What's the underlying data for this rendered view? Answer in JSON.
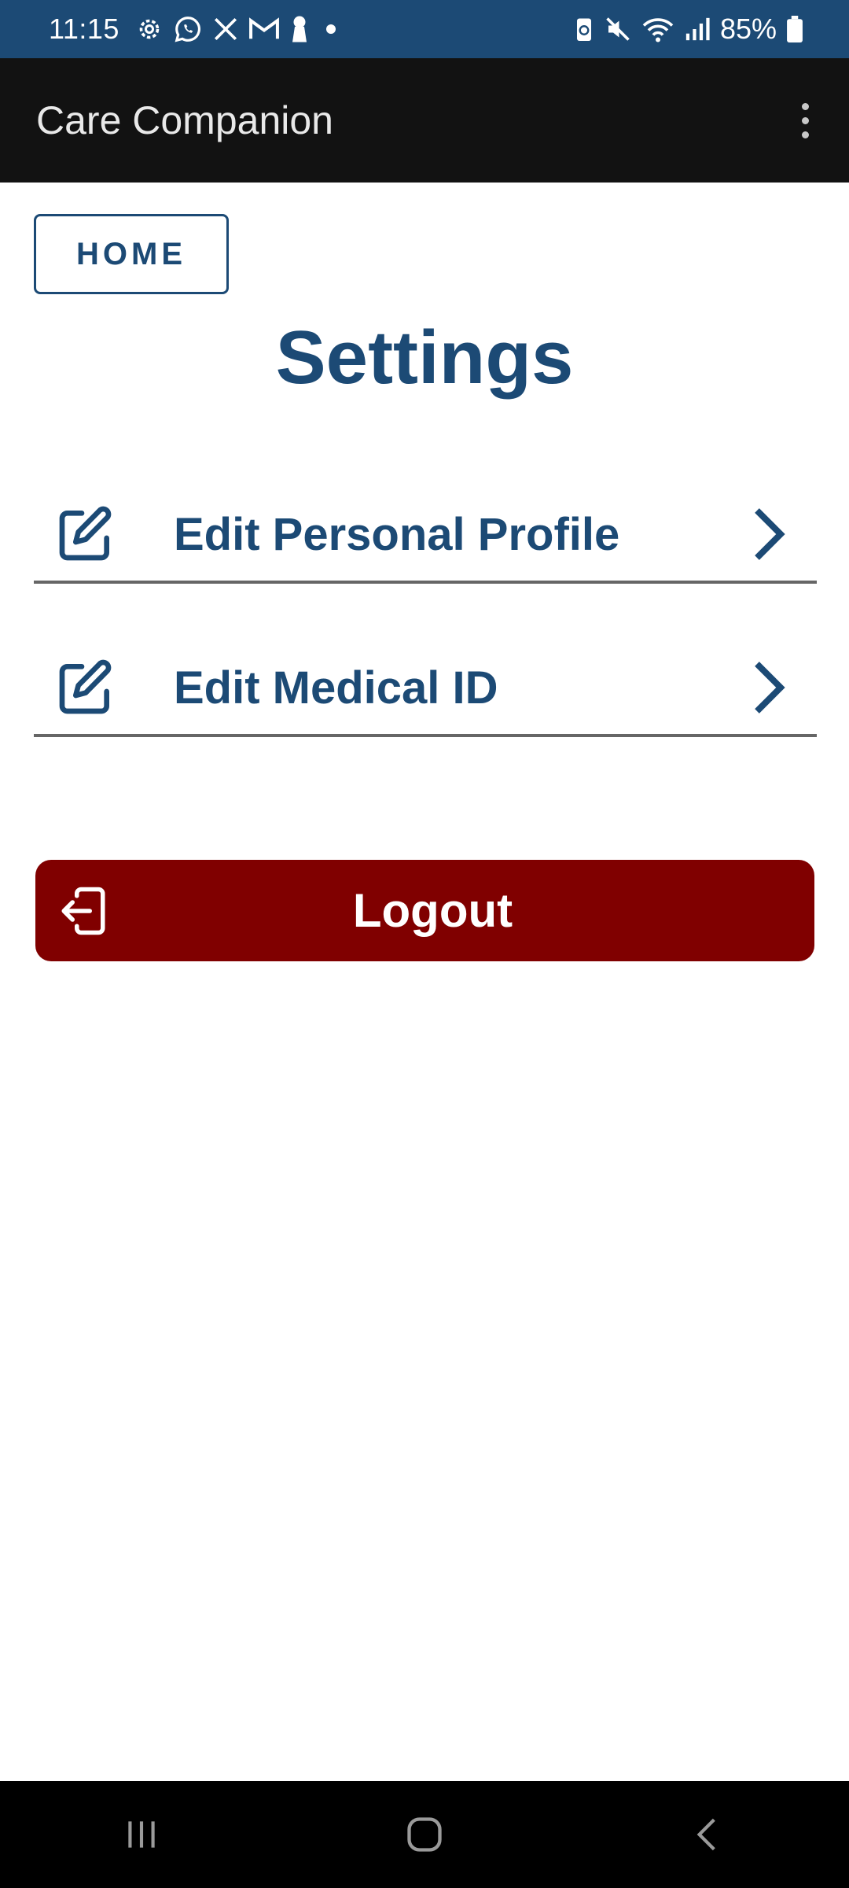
{
  "status_bar": {
    "time": "11:15",
    "battery": "85%",
    "left_icons": [
      "settings-gear-icon",
      "whatsapp-icon",
      "x-twitter-icon",
      "gmail-icon",
      "keyhole-icon",
      "notification-dot-icon"
    ],
    "right_icons": [
      "battery-saver-icon",
      "mute-icon",
      "wifi-icon",
      "signal-icon",
      "battery-icon"
    ]
  },
  "app_bar": {
    "title": "Care Companion",
    "menu_icon": "more-vert-icon"
  },
  "home_button": {
    "label": "HOME"
  },
  "page_title": "Settings",
  "settings_items": [
    {
      "label": "Edit Personal Profile",
      "icon": "edit-icon",
      "trailing_icon": "chevron-right-icon"
    },
    {
      "label": "Edit Medical ID",
      "icon": "edit-icon",
      "trailing_icon": "chevron-right-icon"
    }
  ],
  "logout_button": {
    "label": "Logout",
    "icon": "logout-icon"
  },
  "nav_bar": {
    "buttons": [
      "recent-apps-icon",
      "home-icon",
      "back-icon"
    ]
  },
  "colors": {
    "primary": "#1c4a75",
    "app_bar_bg": "#121212",
    "logout_bg": "#800000",
    "divider": "#666666"
  }
}
